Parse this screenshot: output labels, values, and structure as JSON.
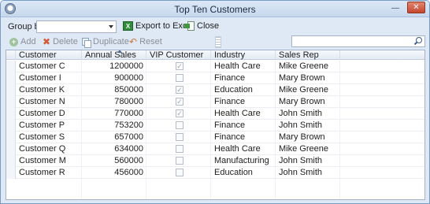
{
  "window": {
    "title": "Top Ten Customers"
  },
  "toolbar": {
    "group_by_label": "Group by",
    "group_by_value": "",
    "export_label": "Export to Excel",
    "close_label": "Close"
  },
  "actions": {
    "add_label": "Add",
    "delete_label": "Delete",
    "duplicate_label": "Duplicate",
    "reset_label": "Reset",
    "search_placeholder": ""
  },
  "grid": {
    "columns": [
      "Customer",
      "Annual Sales",
      "VIP Customer",
      "Industry",
      "Sales Rep"
    ],
    "sorted_column": "Annual Sales",
    "rows": [
      {
        "customer": "Customer C",
        "annual_sales": "1200000",
        "vip": true,
        "industry": "Health Care",
        "sales_rep": "Mike Greene"
      },
      {
        "customer": "Customer I",
        "annual_sales": "900000",
        "vip": false,
        "industry": "Finance",
        "sales_rep": "Mary Brown"
      },
      {
        "customer": "Customer K",
        "annual_sales": "850000",
        "vip": true,
        "industry": "Education",
        "sales_rep": "Mike Greene"
      },
      {
        "customer": "Customer N",
        "annual_sales": "780000",
        "vip": true,
        "industry": "Finance",
        "sales_rep": "Mary Brown"
      },
      {
        "customer": "Customer D",
        "annual_sales": "770000",
        "vip": true,
        "industry": "Health Care",
        "sales_rep": "John Smith"
      },
      {
        "customer": "Customer P",
        "annual_sales": "753200",
        "vip": false,
        "industry": "Finance",
        "sales_rep": "John Smith"
      },
      {
        "customer": "Customer S",
        "annual_sales": "657000",
        "vip": false,
        "industry": "Finance",
        "sales_rep": "Mary Brown"
      },
      {
        "customer": "Customer Q",
        "annual_sales": "634000",
        "vip": false,
        "industry": "Health Care",
        "sales_rep": "Mike Greene"
      },
      {
        "customer": "Customer M",
        "annual_sales": "560000",
        "vip": false,
        "industry": "Manufacturing",
        "sales_rep": "John Smith"
      },
      {
        "customer": "Customer R",
        "annual_sales": "456000",
        "vip": false,
        "industry": "Education",
        "sales_rep": "John Smith"
      }
    ]
  },
  "colors": {
    "frame": "#dfe9f5",
    "titlebar": "#c7d8ee",
    "close_button": "#c6462e",
    "excel_green": "#2f8c3a"
  },
  "icons": {
    "app": "app-icon",
    "export": "excel-icon",
    "close": "close-view-icon",
    "add": "add-icon",
    "delete": "delete-icon",
    "duplicate": "duplicate-icon",
    "reset": "reset-icon",
    "search": "search-icon"
  }
}
